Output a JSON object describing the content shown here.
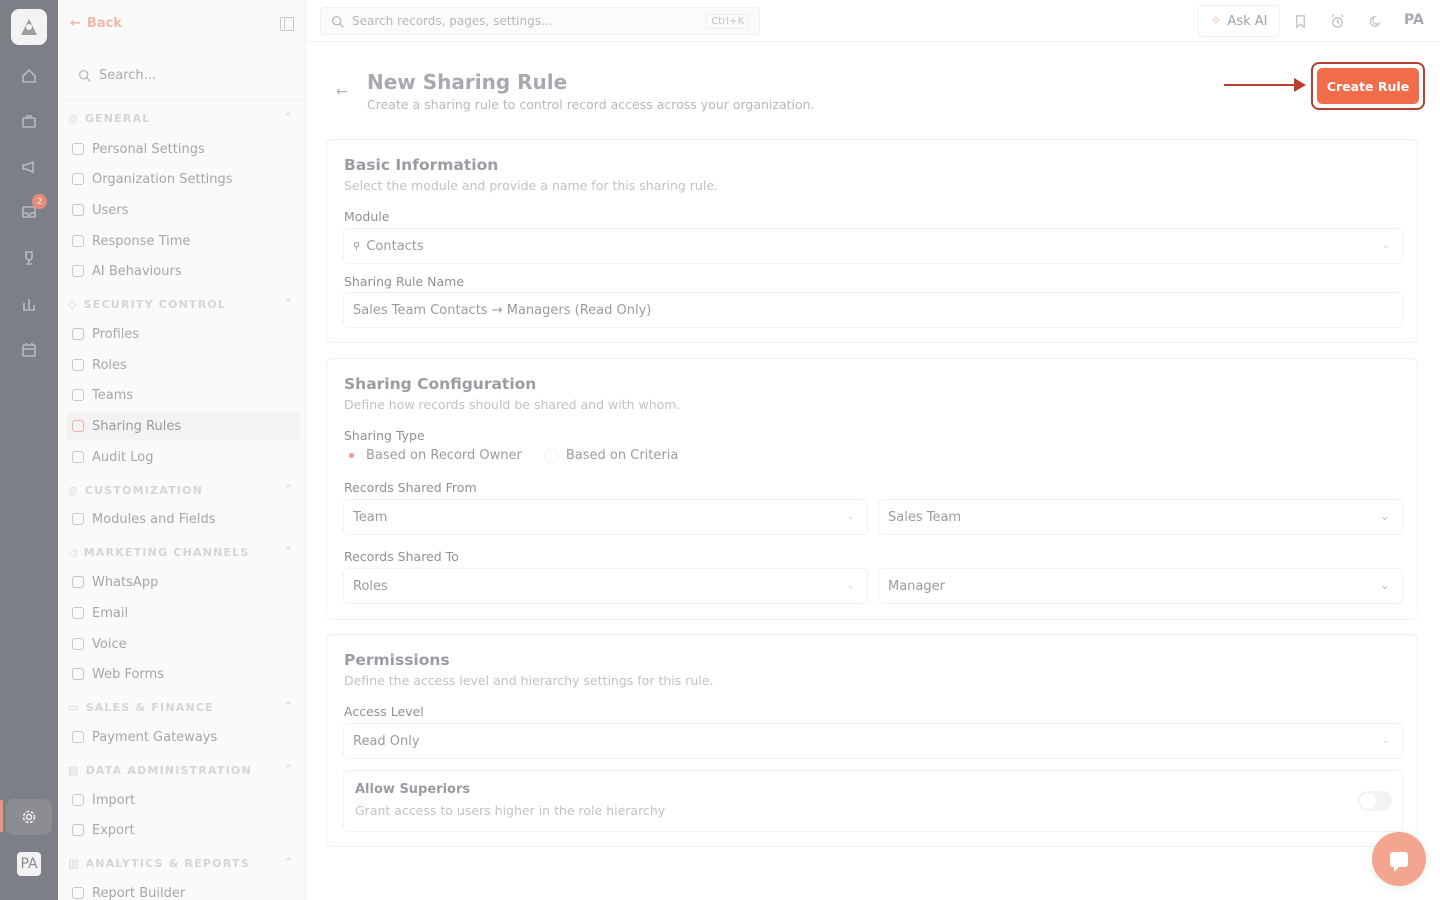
{
  "rail": {
    "badge": "2",
    "avatar": "PA",
    "icons": [
      "home-icon",
      "briefcase-icon",
      "megaphone-icon",
      "inbox-icon",
      "trophy-icon",
      "chart-icon",
      "calendar-icon",
      "gear-icon"
    ]
  },
  "sidebar": {
    "back_label": "Back",
    "search_placeholder": "Search...",
    "groups": [
      {
        "title": "GENERAL",
        "items": [
          "Personal Settings",
          "Organization Settings",
          "Users",
          "Response Time",
          "AI Behaviours"
        ]
      },
      {
        "title": "SECURITY CONTROL",
        "items": [
          "Profiles",
          "Roles",
          "Teams",
          "Sharing Rules",
          "Audit Log"
        ]
      },
      {
        "title": "CUSTOMIZATION",
        "items": [
          "Modules and Fields"
        ]
      },
      {
        "title": "MARKETING CHANNELS",
        "items": [
          "WhatsApp",
          "Email",
          "Voice",
          "Web Forms"
        ]
      },
      {
        "title": "SALES & FINANCE",
        "items": [
          "Payment Gateways"
        ]
      },
      {
        "title": "DATA ADMINISTRATION",
        "items": [
          "Import",
          "Export"
        ]
      },
      {
        "title": "ANALYTICS & REPORTS",
        "items": [
          "Report Builder"
        ]
      }
    ],
    "active_item": "Sharing Rules"
  },
  "topbar": {
    "search_placeholder": "Search records, pages, settings...",
    "shortcut": "Ctrl+K",
    "ask_ai": "Ask AI",
    "user": "PA"
  },
  "page": {
    "title": "New Sharing Rule",
    "subtitle": "Create a sharing rule to control record access across your organization.",
    "create_button": "Create Rule"
  },
  "basic": {
    "title": "Basic Information",
    "desc": "Select the module and provide a name for this sharing rule.",
    "module_label": "Module",
    "module_value": "Contacts",
    "name_label": "Sharing Rule Name",
    "name_value": "Sales Team Contacts → Managers (Read Only)"
  },
  "config": {
    "title": "Sharing Configuration",
    "desc": "Define how records should be shared and with whom.",
    "type_label": "Sharing Type",
    "type_options": [
      "Based on Record Owner",
      "Based on Criteria"
    ],
    "type_selected": "Based on Record Owner",
    "from_label": "Records Shared From",
    "from_type": "Team",
    "from_value": "Sales Team",
    "to_label": "Records Shared To",
    "to_type": "Roles",
    "to_value": "Manager"
  },
  "permissions": {
    "title": "Permissions",
    "desc": "Define the access level and hierarchy settings for this rule.",
    "access_label": "Access Level",
    "access_value": "Read Only",
    "superiors_title": "Allow Superiors",
    "superiors_desc": "Grant access to users higher in the role hierarchy",
    "superiors_enabled": false
  },
  "colors": {
    "accent": "#f06c4a",
    "annotation": "#b84033"
  }
}
